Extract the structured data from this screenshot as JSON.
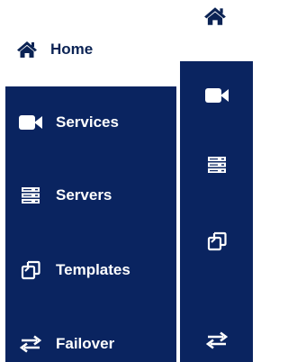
{
  "nav": {
    "home_label": "Home",
    "items": [
      {
        "label": "Services",
        "icon": "video-camera-icon"
      },
      {
        "label": "Servers",
        "icon": "server-icon"
      },
      {
        "label": "Templates",
        "icon": "copy-icon"
      },
      {
        "label": "Failover",
        "icon": "exchange-arrows-icon"
      }
    ]
  },
  "colors": {
    "sidebar_background": "#0a2460",
    "home_text": "#0b2354",
    "item_text": "#ffffff"
  }
}
